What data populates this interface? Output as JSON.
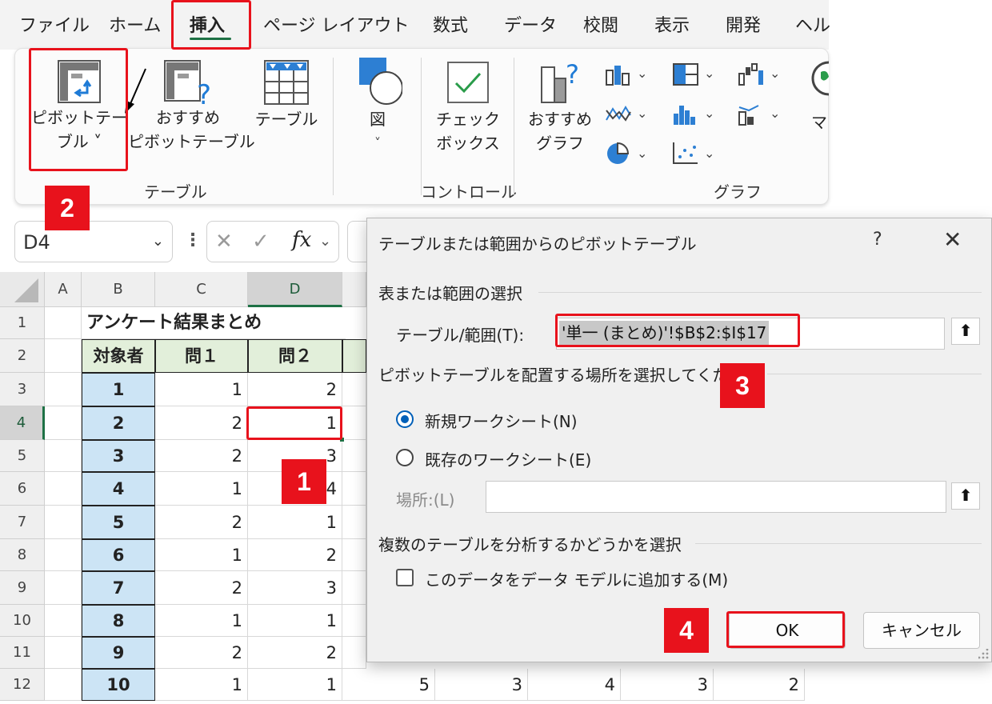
{
  "ribbon_tabs": [
    "ファイル",
    "ホーム",
    "挿入",
    "ページ レイアウト",
    "数式",
    "データ",
    "校閲",
    "表示",
    "開発",
    "ヘル"
  ],
  "ribbon": {
    "pivot_table": {
      "line1": "ピボットテー",
      "line2": "ブル ˅"
    },
    "recommended_pivot": {
      "line1": "おすすめ",
      "line2": "ピボットテーブル"
    },
    "table": {
      "line1": "テーブル"
    },
    "shapes": {
      "line1": "図",
      "line2": "˅"
    },
    "checkbox": {
      "line1": "チェック",
      "line2": "ボックス"
    },
    "recommended_chart": {
      "line1": "おすすめ",
      "line2": "グラフ"
    },
    "maps_partial": "マ",
    "group_table": "テーブル",
    "group_control": "コントロール",
    "group_chart": "グラフ"
  },
  "name_box": {
    "value": "D4"
  },
  "formula_bar": {
    "fx": "fx"
  },
  "sheet": {
    "columns": [
      "A",
      "B",
      "C",
      "D"
    ],
    "rows": [
      "1",
      "2",
      "3",
      "4",
      "5",
      "6",
      "7",
      "8",
      "9",
      "10",
      "11",
      "12"
    ],
    "title": "アンケート結果まとめ",
    "headers": [
      "対象者",
      "問１",
      "問２"
    ],
    "data": [
      {
        "id": "1",
        "q1": "1",
        "q2": "2"
      },
      {
        "id": "2",
        "q1": "2",
        "q2": "1"
      },
      {
        "id": "3",
        "q1": "2",
        "q2": "3"
      },
      {
        "id": "4",
        "q1": "1",
        "q2": "4"
      },
      {
        "id": "5",
        "q1": "2",
        "q2": "1"
      },
      {
        "id": "6",
        "q1": "1",
        "q2": "2"
      },
      {
        "id": "7",
        "q1": "2",
        "q2": "3"
      },
      {
        "id": "8",
        "q1": "1",
        "q2": "1"
      },
      {
        "id": "9",
        "q1": "2",
        "q2": "2"
      },
      {
        "id": "10",
        "q1": "1",
        "q2": "1"
      }
    ],
    "row12_extra": [
      "5",
      "3",
      "4",
      "3",
      "2"
    ]
  },
  "dialog": {
    "title": "テーブルまたは範囲からのピボットテーブル",
    "help": "?",
    "close": "✕",
    "section1": "表または範囲の選択",
    "range_label": "テーブル/範囲(T):",
    "range_value": "'単一 (まとめ)'!$B$2:$I$17",
    "section2": "ピボットテーブルを配置する場所を選択してくだ",
    "radio_new": "新規ワークシート(N)",
    "radio_existing": "既存のワークシート(E)",
    "location_label": "場所:(L)",
    "section3": "複数のテーブルを分析するかどうかを選択",
    "checkbox_label": "このデータをデータ モデルに追加する(M)",
    "ok": "OK",
    "cancel": "キャンセル"
  },
  "annotations": {
    "badge1": "1",
    "badge2": "2",
    "badge3": "3",
    "badge4": "4"
  },
  "colors": {
    "excel_green": "#1e7145",
    "annotation_red": "#e8121c",
    "header_fill": "#e2efda",
    "id_fill": "#cce4f5",
    "accent_blue": "#005fb8"
  }
}
